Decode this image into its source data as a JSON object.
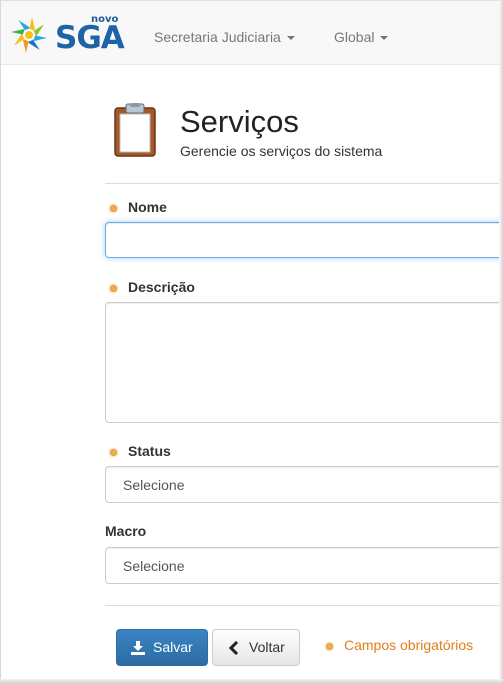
{
  "brand": {
    "superscript": "novo",
    "name": "SGA"
  },
  "nav": {
    "items": [
      {
        "label": "Secretaria Judiciaria"
      },
      {
        "label": "Global"
      }
    ]
  },
  "header": {
    "title": "Serviços",
    "subtitle": "Gerencie os serviços do sistema"
  },
  "form": {
    "nome": {
      "label": "Nome",
      "value": ""
    },
    "descricao": {
      "label": "Descrição",
      "value": ""
    },
    "status": {
      "label": "Status",
      "selected": "Selecione"
    },
    "macro": {
      "label": "Macro",
      "selected": "Selecione"
    }
  },
  "actions": {
    "save_label": "Salvar",
    "back_label": "Voltar",
    "required_note": "Campos obrigatórios"
  },
  "colors": {
    "primary": "#337ab7",
    "required": "#f0ad4e",
    "required_text": "#e27d1b",
    "brand": "#1e63a6"
  }
}
